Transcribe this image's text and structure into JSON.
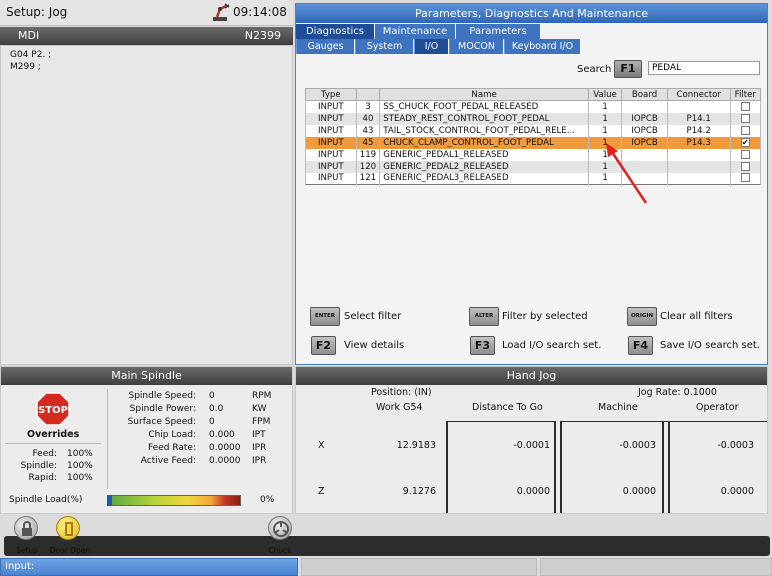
{
  "topbar": {
    "mode": "Setup: Jog",
    "time": "09:14:08"
  },
  "mdi": {
    "title": "MDI",
    "n_number": "N2399",
    "lines": [
      "G04 P2. ;",
      "M299 ;"
    ]
  },
  "param": {
    "title": "Parameters, Diagnostics And Maintenance",
    "tabs_top": [
      "Diagnostics",
      "Maintenance",
      "Parameters"
    ],
    "tabs_sub": [
      "Gauges",
      "System",
      "I/O",
      "MOCON",
      "Keyboard I/O"
    ],
    "search_label": "Search",
    "search_key": "F1",
    "search_value": "PEDAL",
    "columns": [
      "Type",
      "",
      "Name",
      "Value",
      "Board",
      "Connector",
      "Filter"
    ],
    "rows": [
      {
        "type": "INPUT",
        "num": "3",
        "name": "SS_CHUCK_FOOT_PEDAL_RELEASED",
        "value": "1",
        "board": "",
        "connector": "",
        "filter": false
      },
      {
        "type": "INPUT",
        "num": "40",
        "name": "STEADY_REST_CONTROL_FOOT_PEDAL",
        "value": "1",
        "board": "IOPCB",
        "connector": "P14.1",
        "filter": false
      },
      {
        "type": "INPUT",
        "num": "43",
        "name": "TAIL_STOCK_CONTROL_FOOT_PEDAL_RELE...",
        "value": "1",
        "board": "IOPCB",
        "connector": "P14.2",
        "filter": false
      },
      {
        "type": "INPUT",
        "num": "45",
        "name": "CHUCK_CLAMP_CONTROL_FOOT_PEDAL",
        "value": "1",
        "board": "IOPCB",
        "connector": "P14.3",
        "filter": true
      },
      {
        "type": "INPUT",
        "num": "119",
        "name": "GENERIC_PEDAL1_RELEASED",
        "value": "1",
        "board": "",
        "connector": "",
        "filter": false
      },
      {
        "type": "INPUT",
        "num": "120",
        "name": "GENERIC_PEDAL2_RELEASED",
        "value": "1",
        "board": "",
        "connector": "",
        "filter": false
      },
      {
        "type": "INPUT",
        "num": "121",
        "name": "GENERIC_PEDAL3_RELEASED",
        "value": "1",
        "board": "",
        "connector": "",
        "filter": false
      }
    ],
    "hints": [
      {
        "key": "ENTER",
        "label": "Select filter"
      },
      {
        "key": "ALTER",
        "label": "Filter by selected"
      },
      {
        "key": "ORIGIN",
        "label": "Clear all filters"
      },
      {
        "key": "F2",
        "label": "View details"
      },
      {
        "key": "F3",
        "label": "Load I/O search set."
      },
      {
        "key": "F4",
        "label": "Save I/O search set."
      }
    ],
    "selected_color": "#f09a3c"
  },
  "spindle": {
    "title": "Main Spindle",
    "overrides_label": "Overrides",
    "overrides": [
      {
        "label": "Feed:",
        "value": "100%"
      },
      {
        "label": "Spindle:",
        "value": "100%"
      },
      {
        "label": "Rapid:",
        "value": "100%"
      }
    ],
    "stats": [
      {
        "label": "Spindle Speed:",
        "value": "0",
        "unit": "RPM"
      },
      {
        "label": "Spindle Power:",
        "value": "0.0",
        "unit": "KW"
      },
      {
        "label": "Surface Speed:",
        "value": "0",
        "unit": "FPM"
      },
      {
        "label": "Chip Load:",
        "value": "0.000",
        "unit": "IPT"
      },
      {
        "label": "Feed Rate:",
        "value": "0.0000",
        "unit": "IPR"
      },
      {
        "label": "Active Feed:",
        "value": "0.0000",
        "unit": "IPR"
      }
    ],
    "load_label": "Spindle Load(%)",
    "load_value": "0%",
    "load_fraction": 0.0
  },
  "jog": {
    "title": "Hand Jog",
    "position_label": "Position: (IN)",
    "jog_rate": "Jog Rate: 0.1000",
    "columns": [
      "Work G54",
      "Distance To Go",
      "Machine",
      "Operator"
    ],
    "axes": [
      {
        "axis": "X",
        "values": [
          "12.9183",
          "-0.0001",
          "-0.0003",
          "-0.0003"
        ]
      },
      {
        "axis": "Z",
        "values": [
          "9.1276",
          "0.0000",
          "0.0000",
          "0.0000"
        ]
      }
    ]
  },
  "bottom": {
    "icons": [
      {
        "name": "lock-icon",
        "label": "Setup"
      },
      {
        "name": "door-open-icon",
        "label": "Door Open"
      },
      {
        "name": "chuck-icon",
        "label": "Chuck"
      }
    ],
    "input_label": "Input:"
  }
}
